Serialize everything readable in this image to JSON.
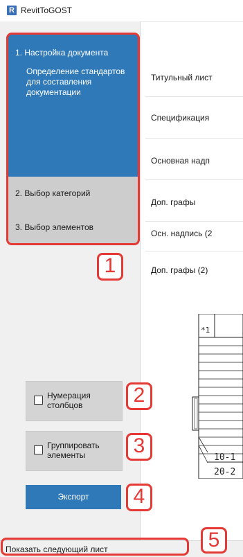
{
  "window": {
    "app_logo": "R",
    "title": "RevitToGOST"
  },
  "steps": {
    "active": {
      "title": "1. Настройка документа",
      "description": "Определение стандартов для составления документации"
    },
    "items": [
      {
        "label": "2. Выбор категорий"
      },
      {
        "label": "3. Выбор элементов"
      }
    ]
  },
  "options": {
    "numbering": "Нумерация столбцов",
    "grouping": "Группировать элементы",
    "export_label": "Экспорт"
  },
  "main_list": [
    "Титульный лист",
    "Спецификация",
    "Основная надп",
    "Доп. графы",
    "Осн. надпись (2",
    "Доп. графы (2)"
  ],
  "preview": {
    "cell_label": "*1",
    "row1": "10-1",
    "row2": "20-2"
  },
  "status": {
    "text": "Показать следующий лист"
  },
  "callouts": [
    "1",
    "2",
    "3",
    "4",
    "5"
  ],
  "colors": {
    "accent": "#2f79b8",
    "callout": "#e53935",
    "inactive_step": "#cdcdcd"
  }
}
